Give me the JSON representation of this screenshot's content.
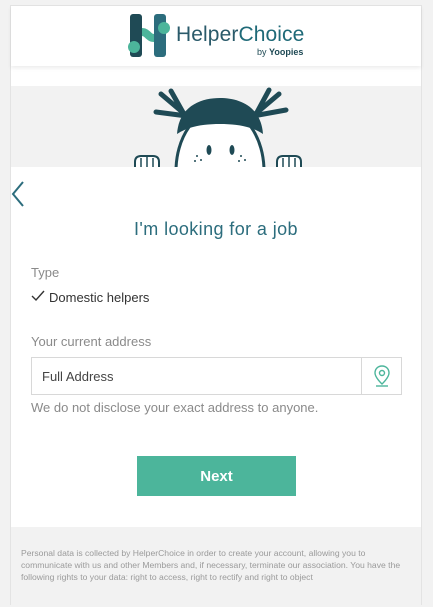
{
  "header": {
    "brand_helper": "Helper",
    "brand_choice": "Choice",
    "by_text": "by",
    "by_brand": "Yoopies"
  },
  "page": {
    "title": "I'm looking for a job"
  },
  "form": {
    "type_label": "Type",
    "type_value": "Domestic helpers",
    "address_label": "Your current address",
    "address_placeholder": "Full Address",
    "address_hint": "We do not disclose your exact address to anyone.",
    "next_label": "Next"
  },
  "footer": {
    "notice": "Personal data is collected by HelperChoice in order to create your account, allowing you to communicate with us and other Members and, if necessary, terminate our association. You have the following rights to your data: right to access, right to rectify and right to object"
  },
  "colors": {
    "primary_teal": "#4cb59b",
    "brand_dark": "#1f4a55",
    "title": "#2c6d7d"
  },
  "icons": [
    "back-chevron-icon",
    "check-icon",
    "location-pin-icon",
    "logo-h-icon"
  ]
}
